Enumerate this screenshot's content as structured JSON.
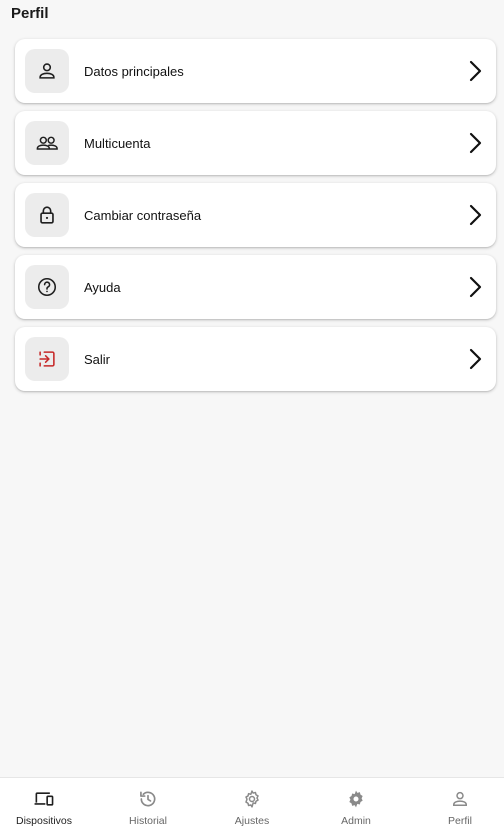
{
  "header": {
    "title": "Perfil"
  },
  "menu": [
    {
      "label": "Datos principales",
      "icon": "person-icon"
    },
    {
      "label": "Multicuenta",
      "icon": "people-icon"
    },
    {
      "label": "Cambiar contraseña",
      "icon": "lock-icon"
    },
    {
      "label": "Ayuda",
      "icon": "help-circle-icon"
    },
    {
      "label": "Salir",
      "icon": "logout-icon"
    }
  ],
  "bottom_nav": [
    {
      "label": "Dispositivos",
      "icon": "devices-icon",
      "active": true
    },
    {
      "label": "Historial",
      "icon": "history-icon"
    },
    {
      "label": "Ajustes",
      "icon": "gear-outline-icon"
    },
    {
      "label": "Admin",
      "icon": "gear-filled-icon"
    },
    {
      "label": "Perfil",
      "icon": "person-icon"
    }
  ],
  "colors": {
    "logout_accent": "#c62828",
    "icon_dark": "#1f1f1f",
    "nav_inactive": "#8a8a8a"
  }
}
